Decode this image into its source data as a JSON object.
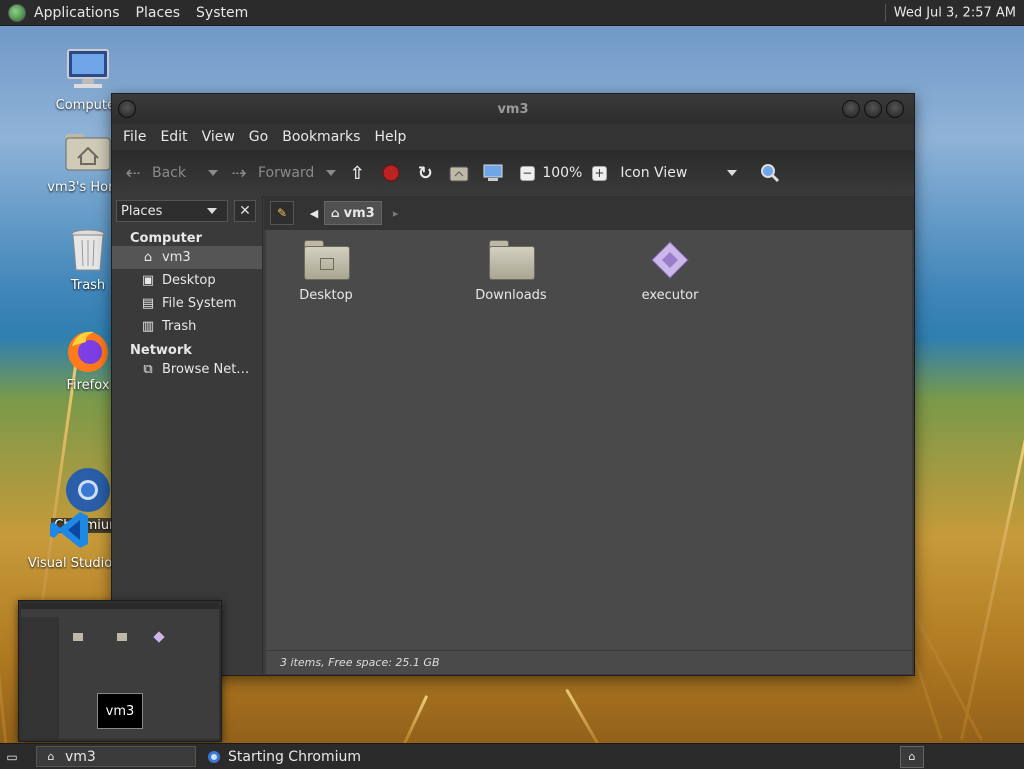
{
  "top_panel": {
    "menus": [
      "Applications",
      "Places",
      "System"
    ],
    "clock": "Wed Jul  3,  2:57 AM"
  },
  "desktop_icons": [
    {
      "label": "Computer",
      "icon": "computer-icon"
    },
    {
      "label": "vm3's Home",
      "icon": "home-folder-icon"
    },
    {
      "label": "Trash",
      "icon": "trash-icon"
    },
    {
      "label": "Firefox",
      "icon": "firefox-icon"
    },
    {
      "label": "Chromium",
      "icon": "chromium-icon"
    },
    {
      "label": "Visual Studio",
      "icon": "vscode-icon"
    }
  ],
  "window": {
    "title": "vm3",
    "menubar": [
      "File",
      "Edit",
      "View",
      "Go",
      "Bookmarks",
      "Help"
    ],
    "toolbar": {
      "back": "Back",
      "forward": "Forward",
      "zoom": "100%",
      "view_mode": "Icon View"
    },
    "sidebar": {
      "selector": "Places",
      "close": "✕",
      "sections": [
        {
          "title": "Computer",
          "items": [
            {
              "label": "vm3",
              "icon": "home-icon",
              "selected": true
            },
            {
              "label": "Desktop",
              "icon": "desktop-icon",
              "selected": false
            },
            {
              "label": "File System",
              "icon": "drive-icon",
              "selected": false
            },
            {
              "label": "Trash",
              "icon": "trash-icon",
              "selected": false
            }
          ]
        },
        {
          "title": "Network",
          "items": [
            {
              "label": "Browse Net…",
              "icon": "network-icon",
              "selected": false
            }
          ]
        }
      ]
    },
    "pathbar": {
      "crumb": "vm3"
    },
    "files": [
      {
        "name": "Desktop",
        "type": "folder-desktop"
      },
      {
        "name": "Downloads",
        "type": "folder"
      },
      {
        "name": "executor",
        "type": "executable"
      }
    ],
    "status": "3 items, Free space: 25.1 GB"
  },
  "thumbnail": {
    "label": "vm3"
  },
  "bottom_panel": {
    "tasks": [
      {
        "label": "vm3",
        "active": true
      },
      {
        "label": "Starting Chromium",
        "active": false
      }
    ]
  }
}
